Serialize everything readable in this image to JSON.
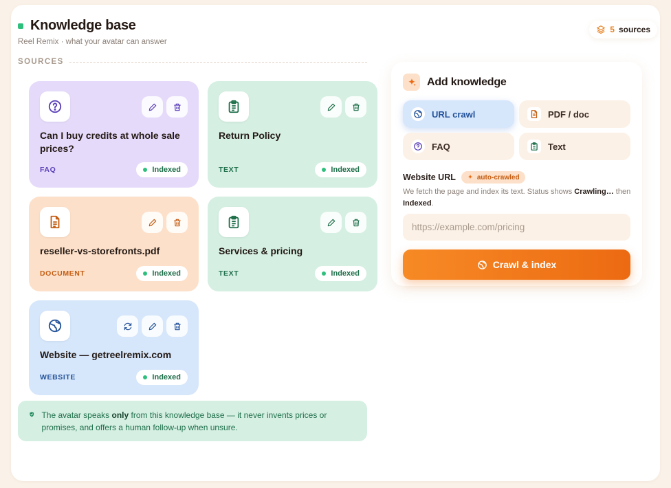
{
  "header": {
    "title": "Knowledge base",
    "subtitle": "Reel Remix · what your avatar can answer",
    "source_count": "5",
    "source_count_label": "sources"
  },
  "sources": {
    "section_label": "SOURCES",
    "cards": [
      {
        "title": "Can I buy credits at whole sale prices?",
        "type": "FAQ",
        "status": "Indexed",
        "icon": "question-circle-icon",
        "color": "#e5dafa",
        "accent": "#5a3fb8"
      },
      {
        "title": "Return Policy",
        "type": "TEXT",
        "status": "Indexed",
        "icon": "clipboard-icon",
        "color": "#d5efe2",
        "accent": "#1f6f4a"
      },
      {
        "title": "reseller-vs-storefronts.pdf",
        "type": "DOCUMENT",
        "status": "Indexed",
        "icon": "document-icon",
        "color": "#fde0c9",
        "accent": "#c45d12"
      },
      {
        "title": "Services & pricing",
        "type": "TEXT",
        "status": "Indexed",
        "icon": "clipboard-icon",
        "color": "#d5efe2",
        "accent": "#1f6f4a"
      },
      {
        "title": "Website — getreelremix.com",
        "type": "WEBSITE",
        "status": "Indexed",
        "icon": "globe-icon",
        "color": "#d6e6fb",
        "accent": "#24539a"
      }
    ]
  },
  "notice": {
    "text_before": "The avatar speaks ",
    "text_bold": "only",
    "text_after": " from this knowledge base — it never invents prices or promises, and offers a human follow-up when unsure."
  },
  "add_knowledge": {
    "title": "Add knowledge",
    "options": [
      {
        "label": "URL crawl",
        "icon": "globe-icon",
        "active": true
      },
      {
        "label": "PDF / doc",
        "icon": "document-icon",
        "active": false
      },
      {
        "label": "FAQ",
        "icon": "question-circle-icon",
        "active": false
      },
      {
        "label": "Text",
        "icon": "clipboard-icon",
        "active": false
      }
    ],
    "url_label": "Website URL",
    "auto_chip": "auto-crawled",
    "help_1": "We fetch the page and index its text. Status shows ",
    "help_bold_1": "Crawling…",
    "help_2": " then ",
    "help_bold_2": "Indexed",
    "help_3": ".",
    "url_value": "",
    "url_placeholder": "https://example.com/pricing",
    "button_label": "Crawl & index"
  },
  "colors": {
    "accent_orange": "#f07a1c",
    "indexed_green": "#2fbf7d"
  }
}
